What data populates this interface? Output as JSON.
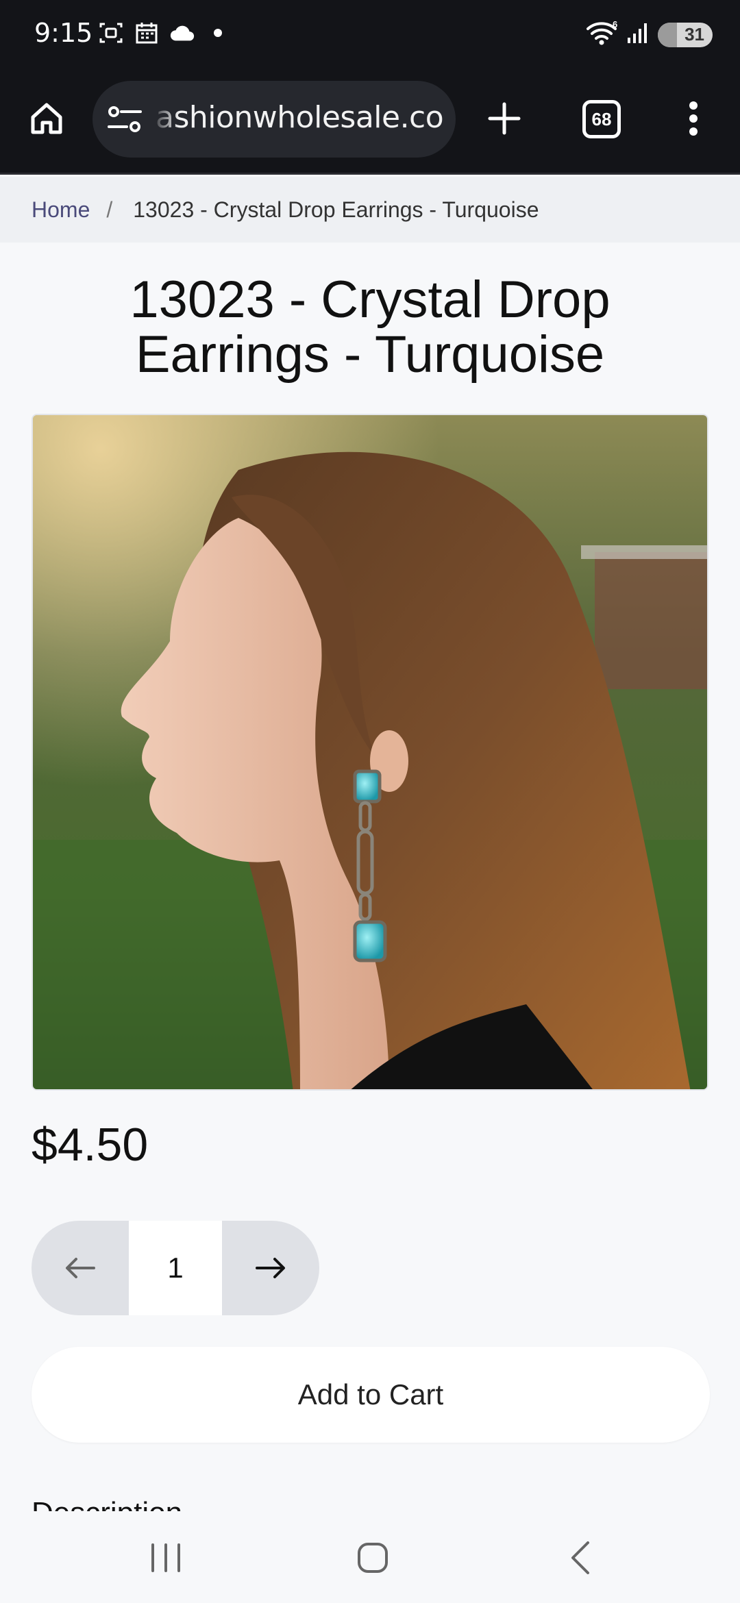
{
  "status_bar": {
    "time": "9:15",
    "wifi_label": "6",
    "battery": "31"
  },
  "browser": {
    "url": "ashionwholesale.com",
    "tab_count": "68"
  },
  "breadcrumb": {
    "home": "Home",
    "separator": "/",
    "current": "13023 - Crystal Drop Earrings - Turquoise"
  },
  "product": {
    "title": "13023 - Crystal Drop Earrings - Turquoise",
    "image_alt": "Woman in profile wearing turquoise crystal drop earrings",
    "price": "$4.50",
    "quantity": "1",
    "add_to_cart": "Add to Cart",
    "description_heading": "Description"
  },
  "colors": {
    "bar_dark": "#131418",
    "page_bg": "#f7f8fa",
    "accent_turquoise": "#35c3cf"
  }
}
